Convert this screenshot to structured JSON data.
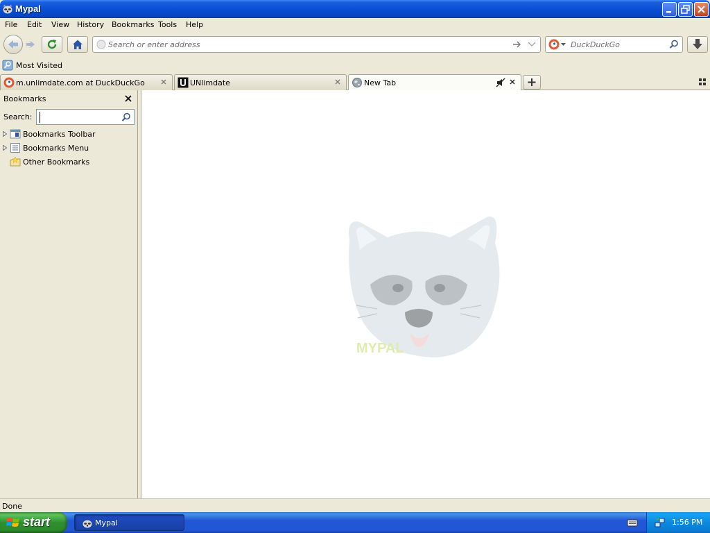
{
  "window": {
    "title": "Mypal",
    "app_icon": "raccoon-icon"
  },
  "menubar": {
    "items": [
      "File",
      "Edit",
      "View",
      "History",
      "Bookmarks",
      "Tools",
      "Help"
    ]
  },
  "navbar": {
    "url_placeholder": "Search or enter address",
    "url_value": "",
    "search_engine_icon": "duckduckgo-icon",
    "search_placeholder": "DuckDuckGo",
    "search_value": ""
  },
  "bookmarks_toolbar": {
    "items": [
      {
        "label": "Most Visited",
        "icon": "most-visited-icon"
      }
    ]
  },
  "tabs": [
    {
      "label": "m.unlimdate.com at DuckDuckGo",
      "icon": "duckduckgo-icon",
      "active": false
    },
    {
      "label": "UNlimdate",
      "icon": "unlimdate-icon",
      "active": false
    },
    {
      "label": "New Tab",
      "icon": "globe-icon",
      "active": true
    }
  ],
  "sidebar": {
    "title": "Bookmarks",
    "search_label": "Search:",
    "search_value": "",
    "tree": [
      {
        "label": "Bookmarks Toolbar",
        "icon": "bookmarks-toolbar-icon",
        "expandable": true
      },
      {
        "label": "Bookmarks Menu",
        "icon": "bookmarks-menu-icon",
        "expandable": true
      },
      {
        "label": "Other Bookmarks",
        "icon": "other-bookmarks-icon",
        "expandable": false
      }
    ]
  },
  "content": {
    "logo_text": "MYPAL"
  },
  "statusbar": {
    "text": "Done"
  },
  "taskbar": {
    "start_label": "start",
    "items": [
      {
        "label": "Mypal",
        "icon": "raccoon-icon"
      }
    ],
    "clock": "1:56 PM"
  },
  "colors": {
    "titlebar_blue": "#0a4fd6",
    "chrome_beige": "#ece9d8",
    "start_green": "#2f8f2f",
    "tray_blue": "#0c8ae0"
  }
}
